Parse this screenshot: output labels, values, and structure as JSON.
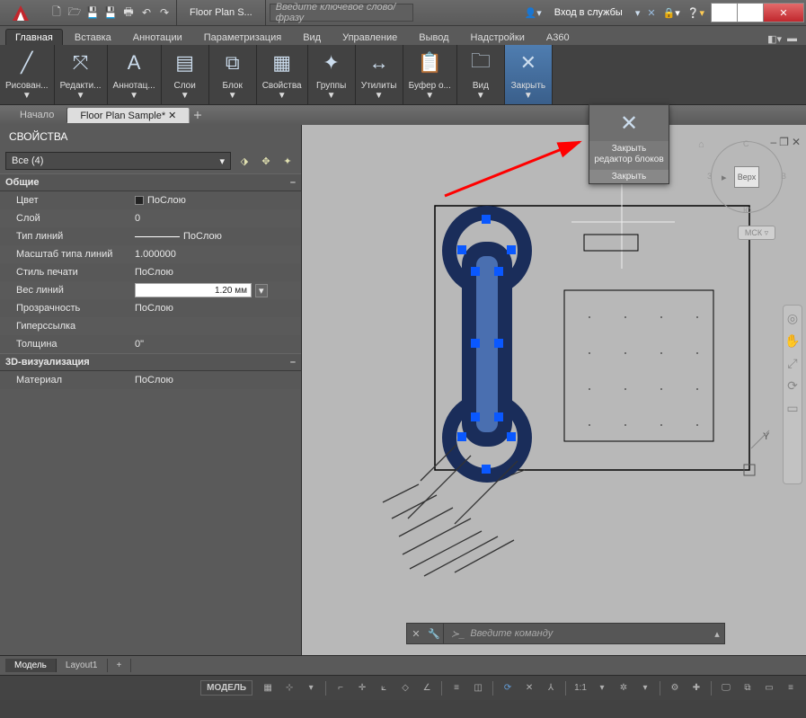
{
  "title_doc": "Floor Plan S...",
  "search_placeholder": "Введите ключевое слово/фразу",
  "login_label": "Вход в службы",
  "menu_tabs": [
    "Главная",
    "Вставка",
    "Аннотации",
    "Параметризация",
    "Вид",
    "Управление",
    "Вывод",
    "Надстройки",
    "A360"
  ],
  "menu_tabs_active": 0,
  "ribbon_panels": [
    {
      "label": "Рисован...",
      "icon": "╱"
    },
    {
      "label": "Редакти...",
      "icon": "⤧"
    },
    {
      "label": "Аннотац...",
      "icon": "A"
    },
    {
      "label": "Слои",
      "icon": "▤"
    },
    {
      "label": "Блок",
      "icon": "⧉"
    },
    {
      "label": "Свойства",
      "icon": "▦"
    },
    {
      "label": "Группы",
      "icon": "✦"
    },
    {
      "label": "Утилиты",
      "icon": "↔"
    },
    {
      "label": "Буфер о...",
      "icon": "📋"
    },
    {
      "label": "Вид",
      "icon": "🗀"
    },
    {
      "label": "Закрыть",
      "icon": "✕"
    }
  ],
  "doc_tabs": [
    {
      "label": "Начало",
      "active": false
    },
    {
      "label": "Floor Plan Sample*",
      "active": true
    }
  ],
  "props_title": "СВОЙСТВА",
  "props_selector": "Все (4)",
  "categories": [
    {
      "name": "Общие"
    },
    {
      "name": "3D-визуализация"
    }
  ],
  "general_rows": [
    {
      "name": "Цвет",
      "value": "ПоСлою",
      "swatch": true
    },
    {
      "name": "Слой",
      "value": "0"
    },
    {
      "name": "Тип линий",
      "value": "ПоСлою",
      "line": true
    },
    {
      "name": "Масштаб типа линий",
      "value": "1.000000"
    },
    {
      "name": "Стиль печати",
      "value": "ПоСлою"
    },
    {
      "name": "Вес линий",
      "value": "1.20 мм",
      "input": true
    },
    {
      "name": "Прозрачность",
      "value": "ПоСлою"
    },
    {
      "name": "Гиперссылка",
      "value": ""
    },
    {
      "name": "Толщина",
      "value": "0\""
    }
  ],
  "viz_rows": [
    {
      "name": "Материал",
      "value": "ПоСлою"
    }
  ],
  "close_panel": {
    "line1": "Закрыть",
    "line2": "редактор блоков",
    "footer": "Закрыть"
  },
  "viewcube": {
    "face": "Верх",
    "n": "С",
    "s": "Ю",
    "e": "В",
    "w": "З"
  },
  "mck": "МСК ▿",
  "cmd_placeholder": "Введите команду",
  "model_tabs": [
    {
      "label": "Модель",
      "active": true
    },
    {
      "label": "Layout1",
      "active": false
    }
  ],
  "status": {
    "model": "МОДЕЛЬ",
    "scale": "1:1"
  }
}
